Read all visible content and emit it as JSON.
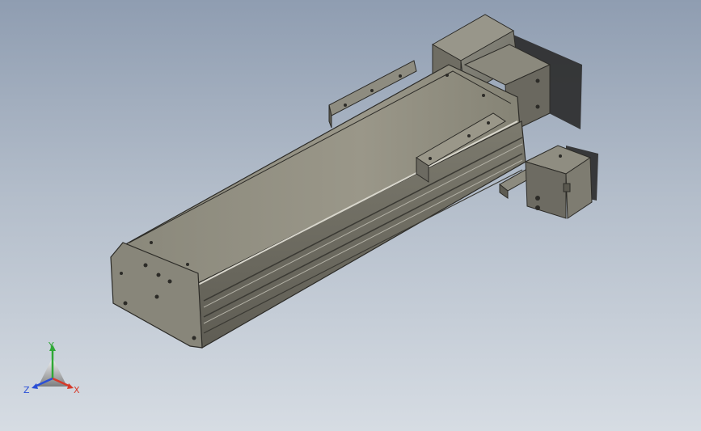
{
  "viewport": {
    "background_top": "#8f9db1",
    "background_bottom": "#d6dce3"
  },
  "model": {
    "body_color": "#7a786c",
    "top_face_color": "#8e8b7e",
    "edge_color": "#2c2b27"
  },
  "triad": {
    "x_label": "X",
    "y_label": "Y",
    "z_label": "Z",
    "x_color": "#d63a2a",
    "y_color": "#2fa836",
    "z_color": "#2a4fd6"
  }
}
